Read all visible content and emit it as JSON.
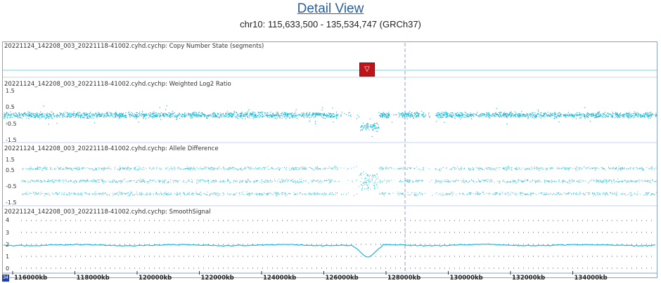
{
  "header": {
    "title": "Detail View",
    "region": "chr10: 115,633,500 - 135,534,747 (GRCh37)"
  },
  "tracks": {
    "copy_number": {
      "label": "20221124_142208_003_20221118-41002.cyhd.cychp: Copy Number State (segments)"
    },
    "log2": {
      "label": "20221124_142208_003_20221118-41002.cyhd.cychp: Weighted Log2 Ratio",
      "ticks": [
        "1.5",
        "0.5",
        "-0.5",
        "-1.5"
      ]
    },
    "allele": {
      "label": "20221124_142208_003_20221118-41002.cyhd.cychp: Allele Difference",
      "ticks": [
        "1.5",
        "0.5",
        "-0.5",
        "-1.5"
      ]
    },
    "smooth": {
      "label": "20221124_142208_003_20221118-41002.cyhd.cychp: SmoothSignal",
      "ticks": [
        "4",
        "3",
        "2",
        "1",
        "0"
      ]
    }
  },
  "marker": {
    "symbol": "▽",
    "color": "#c0141b"
  },
  "axis": {
    "corner_label": "34",
    "labels": [
      "116000kb",
      "118000kb",
      "120000kb",
      "122000kb",
      "124000kb",
      "126000kb",
      "128000kb",
      "130000kb",
      "132000kb",
      "134000kb"
    ]
  },
  "colors": {
    "data": "#1bb8d8",
    "baseline": "#7fd3e6",
    "cursor": "#8e9ef0",
    "border": "#8aa2c8"
  }
}
